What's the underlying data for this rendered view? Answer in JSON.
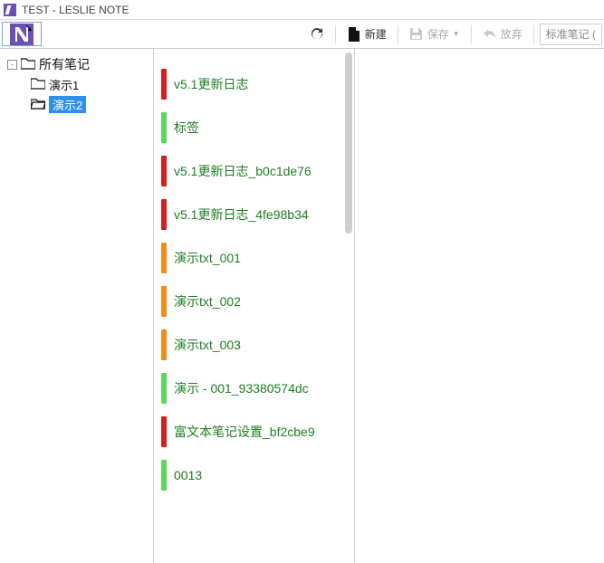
{
  "window": {
    "title": "TEST - LESLIE NOTE"
  },
  "toolbar": {
    "new_label": "新建",
    "save_label": "保存",
    "discard_label": "放弃",
    "dropdown_placeholder": "标准笔记 ("
  },
  "tree": {
    "root_label": "所有笔记",
    "items": [
      {
        "label": "演示1",
        "open": false,
        "selected": false
      },
      {
        "label": "演示2",
        "open": true,
        "selected": true
      }
    ]
  },
  "notes": [
    {
      "color": "red",
      "title": "v5.1更新日志"
    },
    {
      "color": "green",
      "title": "标签"
    },
    {
      "color": "red",
      "title": "v5.1更新日志_b0c1de76"
    },
    {
      "color": "red",
      "title": "v5.1更新日志_4fe98b34"
    },
    {
      "color": "orange",
      "title": "演示txt_001"
    },
    {
      "color": "orange",
      "title": "演示txt_002"
    },
    {
      "color": "orange",
      "title": "演示txt_003"
    },
    {
      "color": "green",
      "title": "演示 - 001_93380574dc"
    },
    {
      "color": "red",
      "title": "富文本笔记设置_bf2cbe9"
    },
    {
      "color": "green",
      "title": "0013"
    }
  ]
}
